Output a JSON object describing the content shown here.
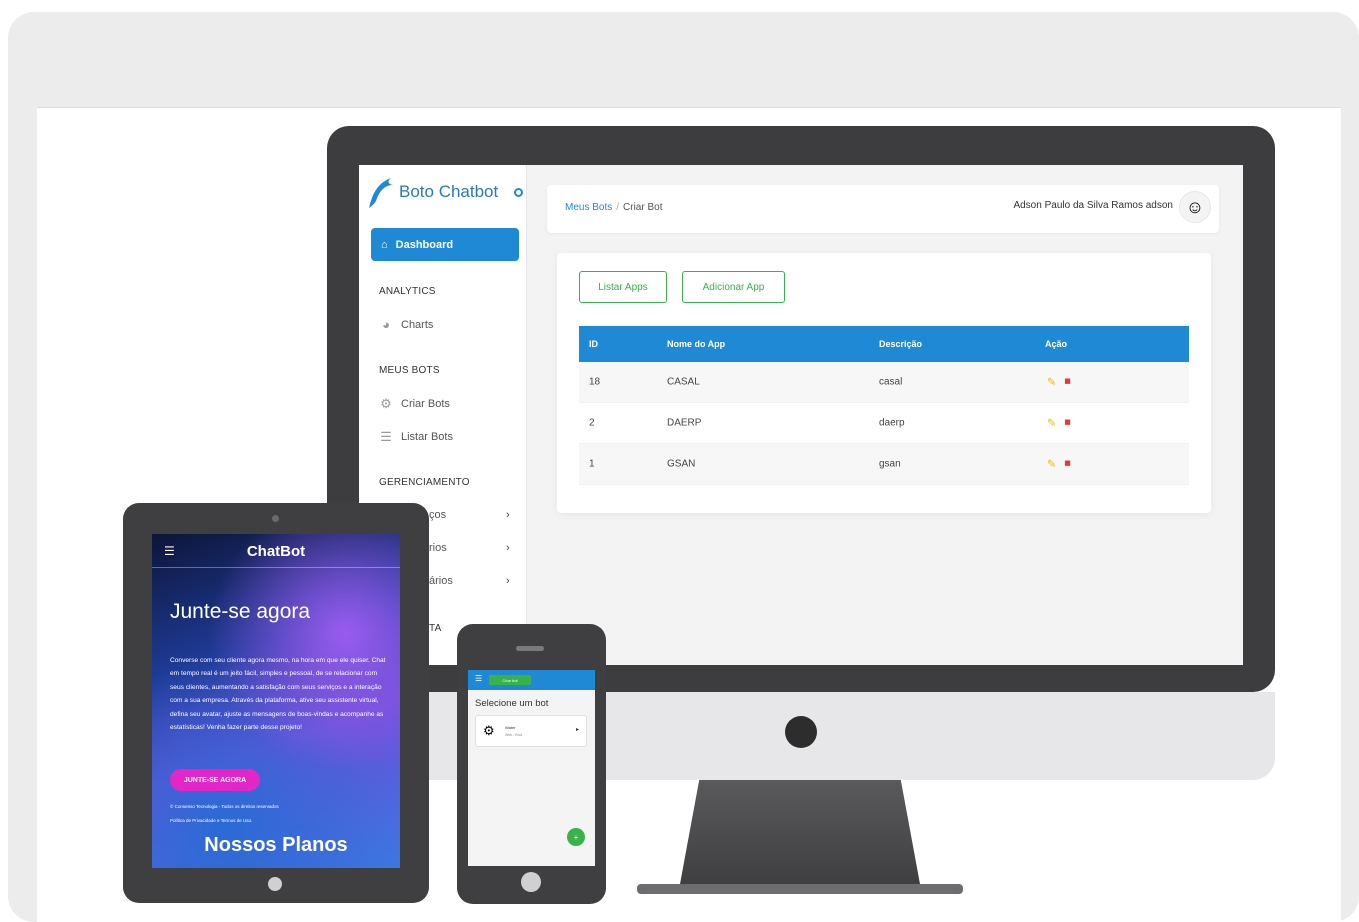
{
  "sidebar": {
    "brand": "Boto Chatbot",
    "dashboard": "Dashboard",
    "sections": {
      "analytics": "ANALYTICS",
      "meus_bots": "MEUS BOTS",
      "gerenciamento": "GERENCIAMENTO"
    },
    "items": {
      "charts": "Charts",
      "criar_bots": "Criar Bots",
      "listar_bots": "Listar Bots",
      "servicos": "ços",
      "usuarios1": "rios",
      "usuarios2": "ários",
      "conta": "TA"
    }
  },
  "breadcrumb": {
    "parent": "Meus Bots",
    "separator": "/",
    "current": "Criar Bot"
  },
  "user": {
    "name": "Adson Paulo da Silva Ramos adson"
  },
  "card": {
    "btn_listar": "Listar Apps",
    "btn_adicionar": "Adicionar App"
  },
  "table": {
    "headers": [
      "ID",
      "Nome do App",
      "Descrição",
      "Ação"
    ],
    "rows": [
      {
        "id": "18",
        "nome": "CASAL",
        "descricao": "casal"
      },
      {
        "id": "2",
        "nome": "DAERP",
        "descricao": "daerp"
      },
      {
        "id": "1",
        "nome": "GSAN",
        "descricao": "gsan"
      }
    ]
  },
  "tablet": {
    "title": "ChatBot",
    "headline": "Junte-se agora",
    "paragraph": "Converse com seu cliente agora mesmo, na hora em que ele quiser. Chat em tempo real é um jeito fácil, simples e pessoal, de se relacionar com seus clientes, aumentando a satisfação com seus serviços e a interação com a sua empresa. Através da plataforma, ative seu assistente virtual, defina seu avatar, ajuste as mensagens de boas-vindas e acompanhe as estatísticas! Venha fazer parte desse projeto!",
    "cta": "JUNTE-SE AGORA",
    "footer1": "© Consenso Tecnologia - Todos os direitos reservados",
    "footer2": "Política de Privacidade e Termos de Uso.",
    "plans": "Nossos Planos"
  },
  "phone": {
    "pill": "Criar bot",
    "title": "Selecione um bot",
    "bot_name": "Water",
    "bot_sub": "Web - Kiva"
  },
  "colors": {
    "primary": "#1f89d6",
    "success": "#37b34a",
    "danger": "#e53935",
    "warning": "#f5b800",
    "cta": "#e226c7"
  }
}
